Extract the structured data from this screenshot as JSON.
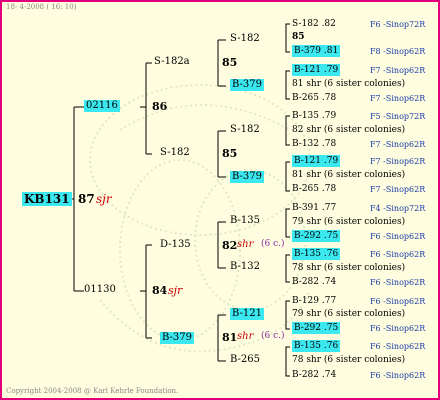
{
  "header": {
    "date_line": "18- 4-2008 ( 16: 10)",
    "copyright": "Copyright 2004-2008 @ Karl Kehrle Foundation."
  },
  "colors": {
    "border": "#e0007c",
    "highlight": "#3ce8f0",
    "shr": "#c80000",
    "note": "#8a2aa8",
    "source": "#1a3ca8"
  },
  "root": {
    "id": "KB131",
    "num": "87",
    "tag": "sjr"
  },
  "gen1": [
    {
      "id": "02116",
      "num": "86"
    },
    {
      "id": "01130",
      "num": "84",
      "tag": "sjr"
    }
  ],
  "gen2": [
    {
      "id": "S-182a",
      "num": "85"
    },
    {
      "id": "S-182",
      "num": "85"
    },
    {
      "id": "D-135",
      "num": "82",
      "tag": "shr",
      "note": "(6 c.)"
    },
    {
      "id": "B-379",
      "num": "81",
      "tag": "shr",
      "note": "(6 c.)"
    }
  ],
  "gen3": [
    "S-182",
    "B-379",
    "S-182",
    "B-379",
    "B-135",
    "B-132",
    "B-121",
    "B-265"
  ],
  "gen4": [
    {
      "id": "S-182 .82",
      "src": "F6 -Sinop72R"
    },
    {
      "id": "85",
      "src": ""
    },
    {
      "id": "B-379 .81",
      "src": "F8 -Sinop62R"
    },
    {
      "id": "B-121 .79",
      "src": "F7 -Sinop62R"
    },
    {
      "id": "81 shr (6 sister colonies)",
      "src": ""
    },
    {
      "id": "B-265 .78",
      "src": "F7 -Sinop62R"
    },
    {
      "id": "B-135 .79",
      "src": "F5 -Sinop72R"
    },
    {
      "id": "82 shr (6 sister colonies)",
      "src": ""
    },
    {
      "id": "B-132 .78",
      "src": "F7 -Sinop62R"
    },
    {
      "id": "B-121 .79",
      "src": "F7 -Sinop62R"
    },
    {
      "id": "81 shr (6 sister colonies)",
      "src": ""
    },
    {
      "id": "B-265 .78",
      "src": "F7 -Sinop62R"
    },
    {
      "id": "B-391 .77",
      "src": "F4 -Sinop72R"
    },
    {
      "id": "79 shr (6 sister colonies)",
      "src": ""
    },
    {
      "id": "B-292 .75",
      "src": "F6 -Sinop62R"
    },
    {
      "id": "B-135 .76",
      "src": "F6 -Sinop62R"
    },
    {
      "id": "78 shr (6 sister colonies)",
      "src": ""
    },
    {
      "id": "B-282 .74",
      "src": "F6 -Sinop62R"
    },
    {
      "id": "B-129 .77",
      "src": "F6 -Sinop62R"
    },
    {
      "id": "79 shr (6 sister colonies)",
      "src": ""
    },
    {
      "id": "B-292 .75",
      "src": "F6 -Sinop62R"
    },
    {
      "id": "B-135 .76",
      "src": "F6 -Sinop62R"
    },
    {
      "id": "78 shr (6 sister colonies)",
      "src": ""
    },
    {
      "id": "B-282 .74",
      "src": "F6 -Sinop62R"
    }
  ]
}
